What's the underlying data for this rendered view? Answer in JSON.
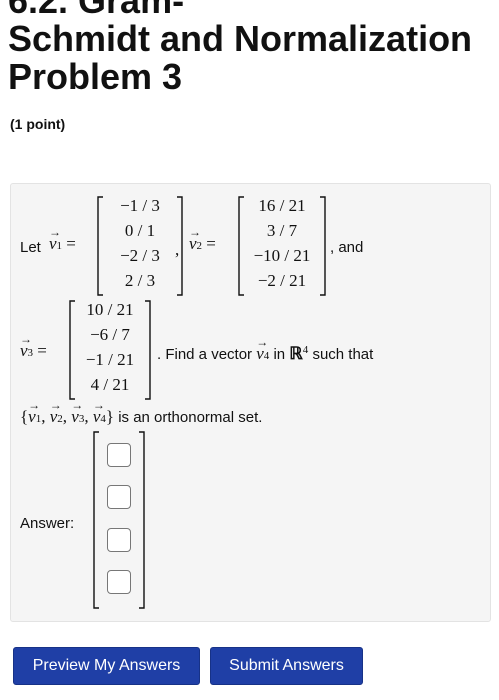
{
  "page": {
    "title_line1": "6.2. Gram-",
    "title_line2": "Schmidt and Normalization",
    "title_line3": "Problem 3",
    "points": "(1 point)"
  },
  "problem": {
    "let": "Let",
    "and": ", and",
    "find_text": ". Find a vector",
    "in_text": "in",
    "such_that": "such that",
    "orthonormal_text": "is an orthonormal set.",
    "set_expr": "{v1, v2, v3, v4}",
    "v1_label": "v1",
    "v2_label": "v2",
    "v3_label": "v3",
    "v4_label": "v4",
    "space": "ℝ",
    "space_exp": "4",
    "v1": [
      "−1 / 3",
      "0 / 1",
      "−2 / 3",
      "2 / 3"
    ],
    "v2": [
      "16 / 21",
      "3 / 7",
      "−10 / 21",
      "−2 / 21"
    ],
    "v3": [
      "10 / 21",
      "−6 / 7",
      "−1 / 21",
      "4 / 21"
    ],
    "answer_label": "Answer:",
    "answer_values": [
      "",
      "",
      "",
      ""
    ]
  },
  "buttons": {
    "preview": "Preview My Answers",
    "submit": "Submit Answers"
  }
}
